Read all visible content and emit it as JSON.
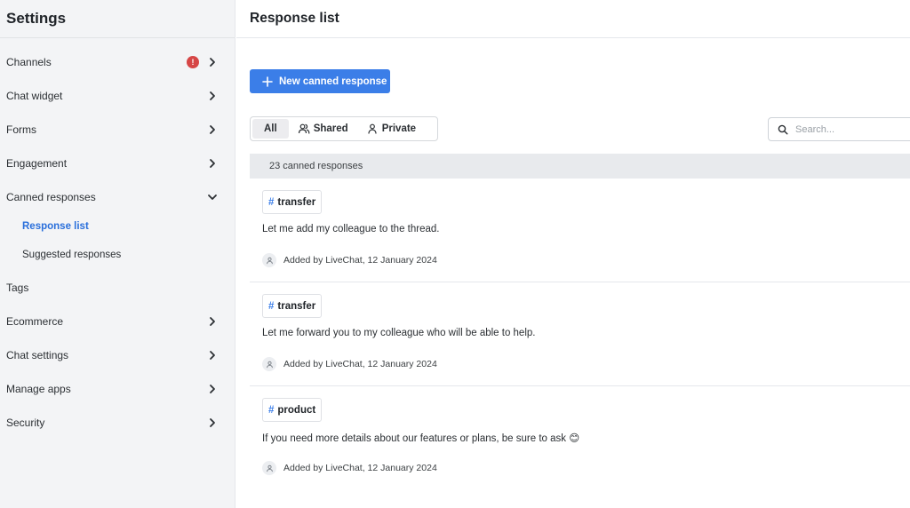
{
  "sidebar": {
    "title": "Settings",
    "items": [
      {
        "label": "Channels",
        "badge": "!",
        "chevron": "right"
      },
      {
        "label": "Chat widget",
        "chevron": "right"
      },
      {
        "label": "Forms",
        "chevron": "right"
      },
      {
        "label": "Engagement",
        "chevron": "right"
      },
      {
        "label": "Canned responses",
        "chevron": "down"
      },
      {
        "label": "Tags"
      },
      {
        "label": "Ecommerce",
        "chevron": "right"
      },
      {
        "label": "Chat settings",
        "chevron": "right"
      },
      {
        "label": "Manage apps",
        "chevron": "right"
      },
      {
        "label": "Security",
        "chevron": "right"
      }
    ],
    "subitems": [
      {
        "label": "Response list",
        "active": true
      },
      {
        "label": "Suggested responses",
        "active": false
      }
    ]
  },
  "main": {
    "title": "Response list",
    "new_button": "New canned response",
    "filters": [
      "All",
      "Shared",
      "Private"
    ],
    "active_filter": "All",
    "search_placeholder": "Search...",
    "count_text": "23 canned responses",
    "responses": [
      {
        "tag": "transfer",
        "text": "Let me add my colleague to the thread.",
        "meta": "Added by LiveChat, 12 January 2024"
      },
      {
        "tag": "transfer",
        "text": "Let me forward you to my colleague who will be able to help.",
        "meta": "Added by LiveChat, 12 January 2024"
      },
      {
        "tag": "product",
        "text": "If you need more details about our features or plans, be sure to ask 😊",
        "meta": "Added by LiveChat, 12 January 2024"
      }
    ]
  },
  "colors": {
    "accent": "#3b7ee8",
    "badge": "#d64646",
    "active_link": "#2a6fdb",
    "sidebar_bg": "#f3f4f6"
  },
  "icons": [
    "chevron-right-icon",
    "chevron-down-icon",
    "plus-icon",
    "users-icon",
    "user-icon",
    "search-icon",
    "avatar-icon"
  ]
}
